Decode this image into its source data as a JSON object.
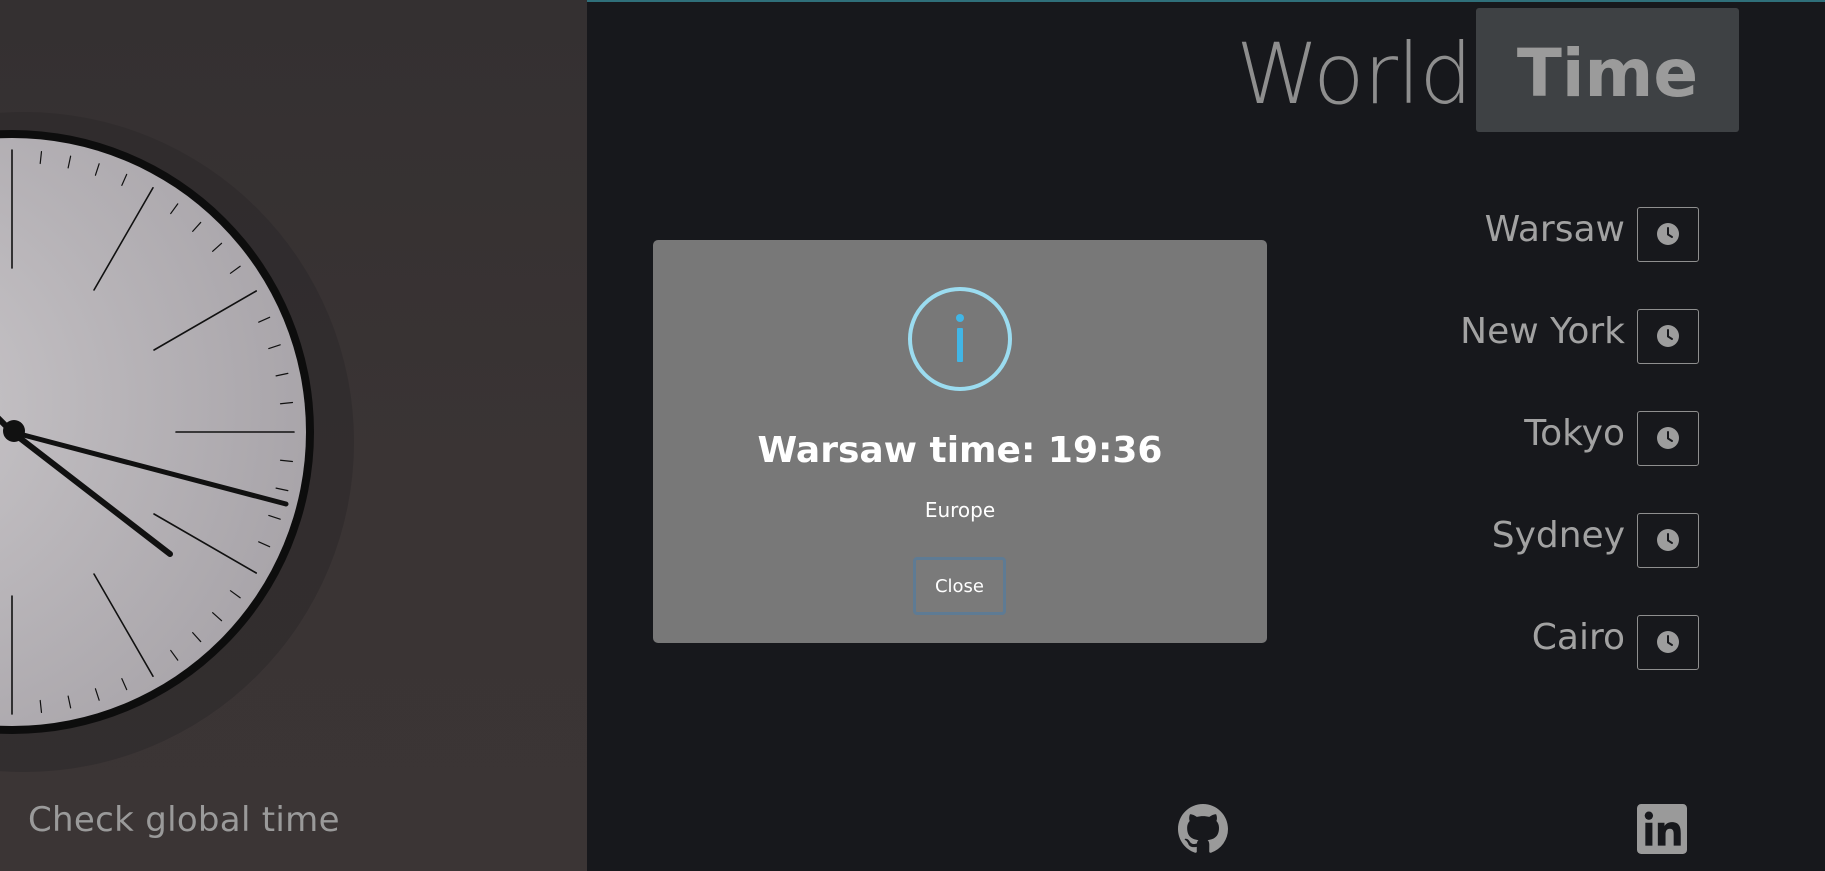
{
  "hero": {
    "tagline": "Check global time"
  },
  "header": {
    "title_light": "World",
    "title_bold": "Time"
  },
  "cities": [
    {
      "name": "Warsaw",
      "icon": "clock-icon"
    },
    {
      "name": "New York",
      "icon": "clock-icon"
    },
    {
      "name": "Tokyo",
      "icon": "clock-icon"
    },
    {
      "name": "Sydney",
      "icon": "clock-icon"
    },
    {
      "name": "Cairo",
      "icon": "clock-icon"
    }
  ],
  "modal": {
    "icon": "info-icon",
    "title": "Warsaw time: 19:36",
    "text": "Europe",
    "close_label": "Close"
  },
  "footer": {
    "github_icon": "github-icon",
    "linkedin_icon": "linkedin-icon"
  },
  "colors": {
    "background": "#17181c",
    "modal": "#787878",
    "info_accent": "#41b6e6",
    "info_ring": "#9bdcf0"
  }
}
